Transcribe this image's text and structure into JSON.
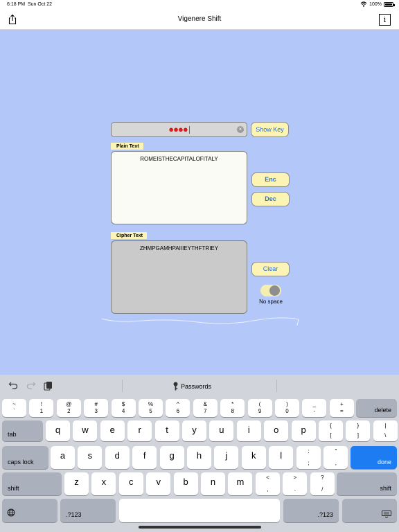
{
  "status_bar": {
    "time": "6:18 PM",
    "date": "Sun Oct 22",
    "battery": "100%"
  },
  "navbar": {
    "title": "Vigenere Shift",
    "share_icon": "share-icon",
    "info_label": "i"
  },
  "key_field": {
    "masked_value": "●●●●",
    "clear_icon": "clear-text-icon"
  },
  "buttons": {
    "show_key": "Show Key",
    "enc": "Enc",
    "dec": "Dec",
    "clear": "Clear"
  },
  "plain": {
    "label": "Plain Text",
    "text": "ROMEISTHECAPITALOFITALY"
  },
  "cipher": {
    "label": "Cipher Text",
    "text": "ZHMPGAMHPAIIIEYTHFTRIEY"
  },
  "toggle": {
    "label": "No space",
    "on": true
  },
  "keyboard": {
    "toolbar": {
      "passwords": "Passwords"
    },
    "row1": [
      {
        "t": "~",
        "b": "`"
      },
      {
        "t": "!",
        "b": "1"
      },
      {
        "t": "@",
        "b": "2"
      },
      {
        "t": "#",
        "b": "3"
      },
      {
        "t": "$",
        "b": "4"
      },
      {
        "t": "%",
        "b": "5"
      },
      {
        "t": "^",
        "b": "6"
      },
      {
        "t": "&",
        "b": "7"
      },
      {
        "t": "*",
        "b": "8"
      },
      {
        "t": "(",
        "b": "9"
      },
      {
        "t": ")",
        "b": "0"
      },
      {
        "t": "_",
        "b": "-"
      },
      {
        "t": "+",
        "b": "="
      }
    ],
    "delete": "delete",
    "tab": "tab",
    "row2": [
      "q",
      "w",
      "e",
      "r",
      "t",
      "y",
      "u",
      "i",
      "o",
      "p"
    ],
    "row2_extra": [
      {
        "t": "{",
        "b": "["
      },
      {
        "t": "}",
        "b": "]"
      },
      {
        "t": "|",
        "b": "\\"
      }
    ],
    "caps": "caps lock",
    "row3": [
      "a",
      "s",
      "d",
      "f",
      "g",
      "h",
      "j",
      "k",
      "l"
    ],
    "row3_extra": [
      {
        "t": ":",
        "b": ";"
      },
      {
        "t": "\"",
        "b": ","
      }
    ],
    "done": "done",
    "shift": "shift",
    "row4": [
      "z",
      "x",
      "c",
      "v",
      "b",
      "n",
      "m"
    ],
    "row4_extra": [
      {
        "t": "<",
        "b": ","
      },
      {
        "t": ">",
        "b": "."
      },
      {
        "t": "?",
        "b": "/"
      }
    ],
    "numbers": ".?123"
  }
}
